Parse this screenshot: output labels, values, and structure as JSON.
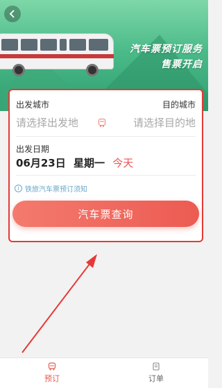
{
  "banner": {
    "slogan_line1": "汽车票预订服务",
    "slogan_line2": "售票开启",
    "back_icon": "chevron-left-icon"
  },
  "form": {
    "from_label": "出发城市",
    "to_label": "目的城市",
    "from_placeholder": "请选择出发地",
    "to_placeholder": "请选择目的地",
    "swap_icon": "swap-icon",
    "date_label": "出发日期",
    "date_value": "06月23日",
    "weekday": "星期一",
    "today_tag": "今天",
    "notice_text": "铁旅汽车票预订须知",
    "search_button": "汽车票查询"
  },
  "tabbar": {
    "tabs": [
      {
        "label": "预订",
        "icon": "bus-icon",
        "active": true
      },
      {
        "label": "订单",
        "icon": "document-icon",
        "active": false
      }
    ]
  },
  "colors": {
    "accent": "#ec5b52",
    "highlight_border": "#e53935",
    "banner_green": "#4cbb8a"
  }
}
